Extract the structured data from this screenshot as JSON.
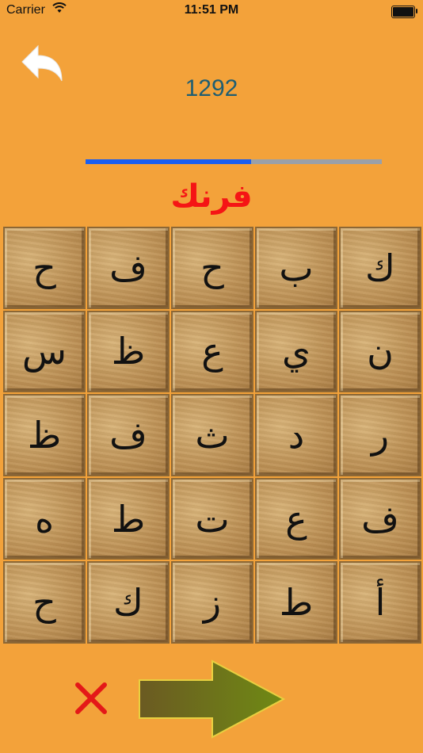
{
  "status_bar": {
    "carrier": "Carrier",
    "time": "11:51 PM"
  },
  "header": {
    "score": "1292",
    "progress_fraction": 0.56
  },
  "target_word": "فرنك",
  "grid": {
    "rows": [
      [
        "ح",
        "ف",
        "ح",
        "ب",
        "ك"
      ],
      [
        "س",
        "ظ",
        "ع",
        "ي",
        "ن"
      ],
      [
        "ظ",
        "ف",
        "ث",
        "د",
        "ر"
      ],
      [
        "ه",
        "ط",
        "ت",
        "ع",
        "ف"
      ],
      [
        "ح",
        "ك",
        "ز",
        "ط",
        "أ"
      ]
    ]
  },
  "icons": {
    "back": "back-arrow-icon",
    "clear": "close-icon",
    "next": "next-arrow-icon",
    "wifi": "wifi-icon",
    "battery": "battery-icon"
  },
  "colors": {
    "background": "#f3a23a",
    "score": "#1f5e72",
    "word": "#f51515",
    "progress_fill": "#1a5ff0",
    "progress_track": "#9aa0a8",
    "close": "#e41818",
    "arrow_fill": "#6f7d1c"
  }
}
